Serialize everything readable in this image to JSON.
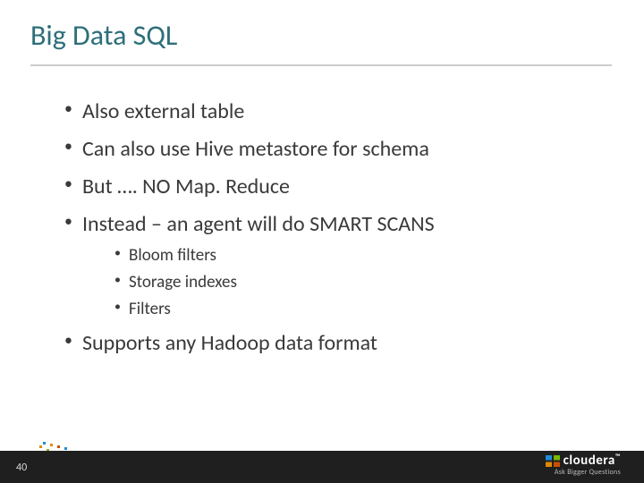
{
  "title": "Big Data SQL",
  "bullets": {
    "0": "Also external table",
    "1": "Can also use Hive metastore for schema",
    "2": "But …. NO Map. Reduce",
    "3": "Instead – an agent will do SMART SCANS",
    "sub": {
      "0": "Bloom filters",
      "1": "Storage indexes",
      "2": "Filters"
    },
    "4": "Supports any Hadoop data format"
  },
  "footer": {
    "page": "40",
    "brand": "cloudera",
    "tagline": "Ask Bigger Questions"
  }
}
